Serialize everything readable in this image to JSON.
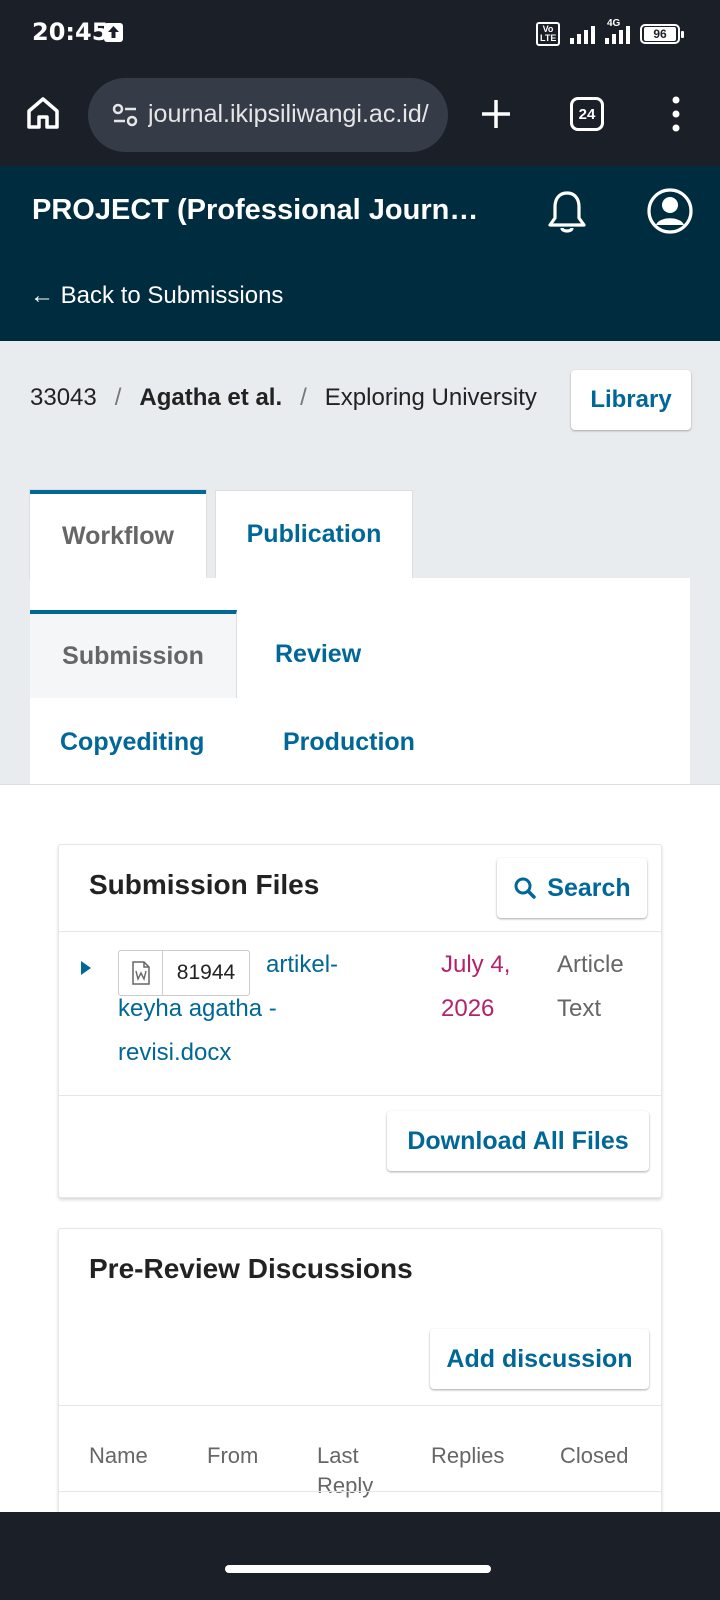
{
  "status_bar": {
    "time": "20:45",
    "volte": "Vo LTE",
    "network": "4G",
    "battery": "96"
  },
  "browser": {
    "url": "journal.ikipsiliwangi.ac.id/",
    "tab_count": "24",
    "icons": [
      "home-icon",
      "site-settings-icon",
      "plus-icon",
      "tabs-icon",
      "more-vert-icon"
    ]
  },
  "header": {
    "journal_title": "PROJECT (Professional Journal of English Education)",
    "back_link": "← Back to Submissions",
    "icons": [
      "bell-icon",
      "user-avatar-icon"
    ],
    "bg_color": "#002c40"
  },
  "breadcrumb": {
    "id": "33043",
    "separator": "/",
    "authors": "Agatha et al.",
    "title": "Exploring University"
  },
  "library_button": "Library",
  "tabs": [
    {
      "label": "Workflow",
      "active": true
    },
    {
      "label": "Publication",
      "active": false
    }
  ],
  "workflow_tabs": [
    {
      "label": "Submission",
      "active": true
    },
    {
      "label": "Review",
      "active": false
    },
    {
      "label": "Copyediting",
      "active": false
    },
    {
      "label": "Production",
      "active": false
    }
  ],
  "submission_files": {
    "title": "Submission Files",
    "search_label": "Search",
    "file": {
      "id": "81944",
      "name": "artikel-keyha agatha - revisi.docx",
      "date": "July 4, 2026",
      "type": "Article Text"
    },
    "download_all": "Download All Files"
  },
  "pre_review": {
    "title": "Pre-Review Discussions",
    "add_label": "Add discussion",
    "columns": [
      "Name",
      "From",
      "Last Reply",
      "Replies",
      "Closed"
    ]
  },
  "colors": {
    "link": "#006798",
    "date": "#b5216d",
    "chrome": "#1b1f27"
  }
}
